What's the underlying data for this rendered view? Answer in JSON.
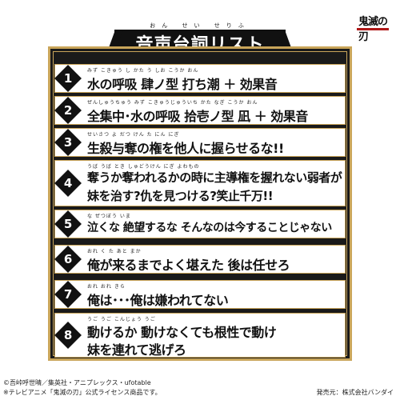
{
  "logo": {
    "text": "鬼滅の刃"
  },
  "title": {
    "ruby": "おん せい せりふ",
    "text": "音声台詞リスト"
  },
  "items": [
    {
      "num": "1",
      "ruby": "みず こきゅう し かた う しお こうか おん",
      "lines": [
        "水の呼吸 肆ノ型 打ち潮 ＋ 効果音"
      ]
    },
    {
      "num": "2",
      "ruby": "ぜんしゅうちゅう みず こきゅうじゅういち かた なぎ こうか おん",
      "lines": [
        "全集中･水の呼吸 拾壱ノ型 凪 ＋ 効果音"
      ]
    },
    {
      "num": "3",
      "ruby": "せいさつ よ だつ けん た にん にぎ",
      "lines": [
        "生殺与奪の権を他人に握らせるな!!"
      ]
    },
    {
      "num": "4",
      "ruby": "うば うば とき しゅどうけん にぎ よわもの",
      "lines": [
        "奪うか奪われるかの時に主導権を握れない弱者が",
        "妹を治す?仇を見つける?笑止千万!!"
      ]
    },
    {
      "num": "5",
      "ruby": "な ぜつぼう いま",
      "lines": [
        "泣くな 絶望するな そんなのは今することじゃない"
      ]
    },
    {
      "num": "6",
      "ruby": "おれ く た あと まか",
      "lines": [
        "俺が来るまでよく堪えた 後は任せろ"
      ]
    },
    {
      "num": "7",
      "ruby": "おれ おれ きら",
      "lines": [
        "俺は･･･俺は嫌われてない"
      ]
    },
    {
      "num": "8",
      "ruby": "うご うご こんじょう うご",
      "lines": [
        "動けるか 動けなくても根性で動け",
        "妹を連れて逃げろ"
      ]
    }
  ],
  "footer": {
    "copyright": "©吾峠呼世晴／集英社・アニプレックス・ufotable",
    "license": "※テレビアニメ「鬼滅の刃」公式ライセンス商品です。",
    "seller": "発売元：株式会社バンダイ"
  }
}
